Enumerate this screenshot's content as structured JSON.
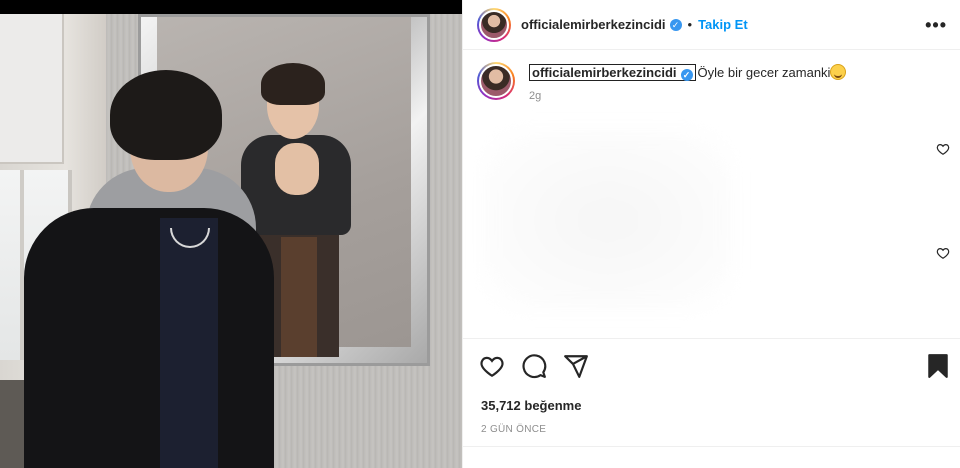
{
  "post": {
    "username": "officialemirberkezincidi",
    "separator": "•",
    "follow_label": "Takip Et",
    "more_label": "•••"
  },
  "caption": {
    "username": "officialemirberkezincidi",
    "text": "Öyle bir gecer zamanki",
    "age": "2g"
  },
  "stats": {
    "likes": "35,712 beğenme",
    "date": "2 GÜN ÖNCE"
  },
  "icons": {
    "like": "heart-icon",
    "comment": "comment-icon",
    "share": "share-icon",
    "save": "bookmark-icon",
    "verified": "verified-badge-icon",
    "emoji": "grinning-sweat-emoji"
  },
  "colors": {
    "accent": "#0095f6",
    "verified": "#3897f0",
    "text": "#262626",
    "muted": "#8e8e8e"
  }
}
